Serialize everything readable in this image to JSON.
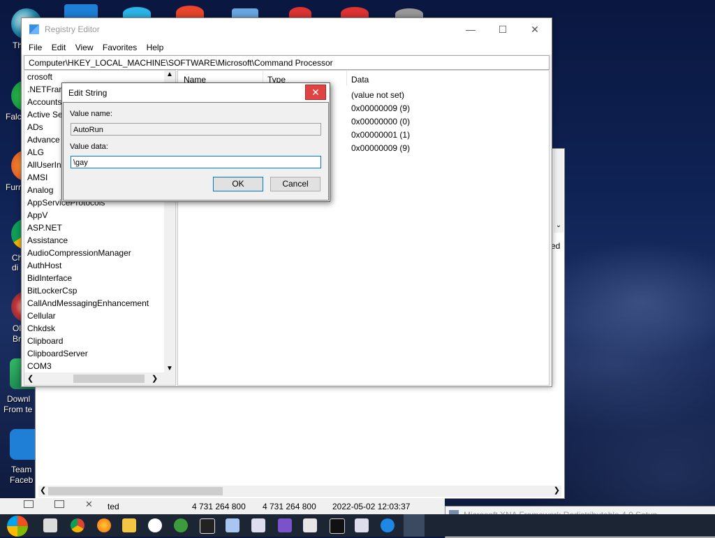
{
  "desktop": {
    "labels": [
      "Th",
      "Falc",
      "Furn",
      "Ch",
      "di",
      "Ol",
      "Br",
      "Downl",
      "From te",
      "Team",
      "Faceb"
    ]
  },
  "registry": {
    "title": "Registry Editor",
    "menu": [
      "File",
      "Edit",
      "View",
      "Favorites",
      "Help"
    ],
    "address": "Computer\\HKEY_LOCAL_MACHINE\\SOFTWARE\\Microsoft\\Command Processor",
    "tree": [
      "crosoft",
      ".NETFram",
      "Accounts",
      "Active Se",
      "ADs",
      "Advance",
      "ALG",
      "AllUserIn",
      "AMSI",
      "Analog",
      "AppServiceProtocols",
      "AppV",
      "ASP.NET",
      "Assistance",
      "AudioCompressionManager",
      "AuthHost",
      "BidInterface",
      "BitLockerCsp",
      "CallAndMessagingEnhancement",
      "Cellular",
      "Chkdsk",
      "Clipboard",
      "ClipboardServer",
      "COM3"
    ],
    "columns": {
      "name": "Name",
      "type": "Type",
      "data": "Data"
    },
    "data_values": [
      "(value not set)",
      "0x00000009 (9)",
      "0x00000000 (0)",
      "0x00000001 (1)",
      "0x00000009 (9)"
    ]
  },
  "dialog": {
    "title": "Edit String",
    "value_name_label": "Value name:",
    "value_name": "AutoRun",
    "value_data_label": "Value data:",
    "value_data": "\\gay",
    "ok": "OK",
    "cancel": "Cancel"
  },
  "background_window": {
    "side_text": "ed"
  },
  "status": {
    "left": "ted",
    "size1": "4 731 264 800",
    "size2": "4 731 264 800",
    "date": "2022-05-02 12:03:37"
  },
  "xna": {
    "title": "Microsoft XNA Framework Redistributable 4.0 Setup"
  },
  "colors": {
    "close_red": "#e04343",
    "taskbar": "#1b2533",
    "selection_blue": "#0078d7"
  }
}
